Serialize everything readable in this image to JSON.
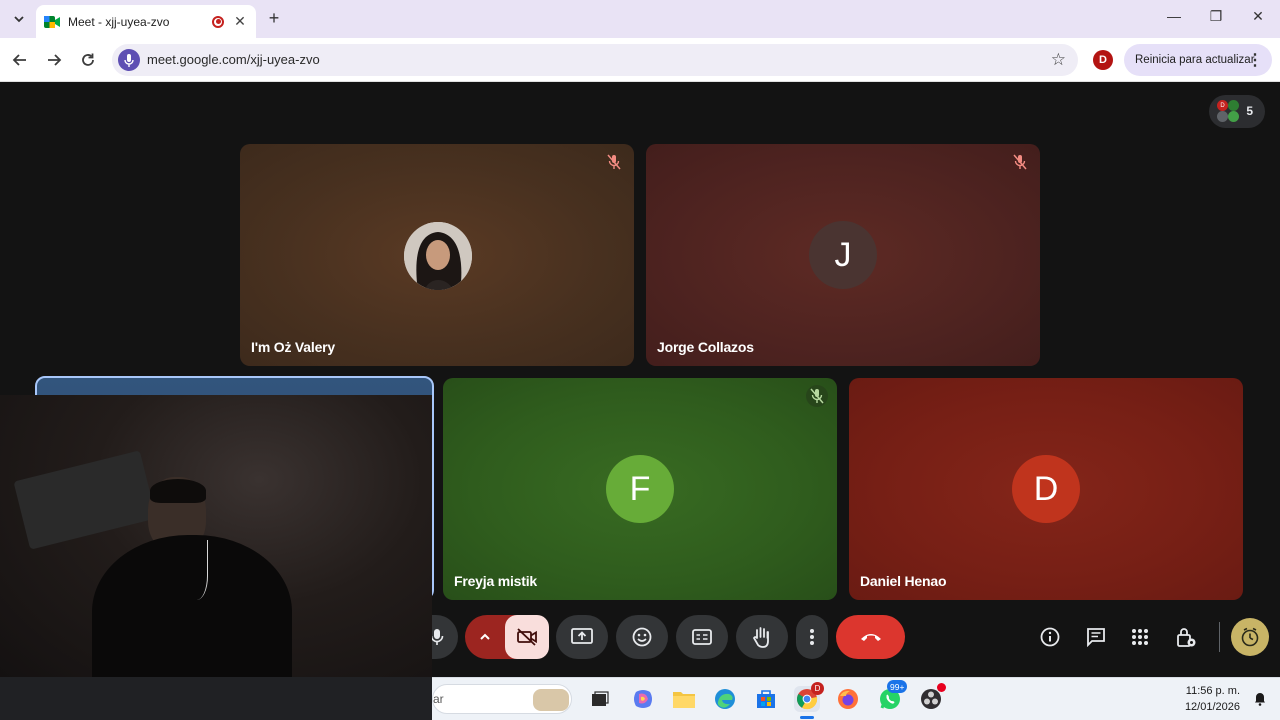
{
  "browser": {
    "tab_title": "Meet - xjj-uyea-zvo",
    "url": "meet.google.com/xjj-uyea-zvo",
    "profile_initial": "D",
    "update_label": "Reinicia para actualizar",
    "new_tab_symbol": "+",
    "tab_close_symbol": "✕",
    "window_controls": [
      "—",
      "❐",
      "✕"
    ]
  },
  "meet": {
    "participant_count": "5",
    "chip_avatar_initial": "D",
    "tiles": [
      {
        "name": "I'm Oż Valery",
        "muted": true,
        "avatar": "photo",
        "color": "#4a2e1e"
      },
      {
        "name": "Jorge Collazos",
        "muted": true,
        "avatar_letter": "J",
        "color": "#4f2320"
      },
      {
        "name": "",
        "muted": false,
        "avatar": "self-illustration",
        "color": "#2b4a6e"
      },
      {
        "name": "Freyja mistik",
        "muted": true,
        "avatar_letter": "F",
        "color": "#2e5a1c"
      },
      {
        "name": "Daniel Henao",
        "muted": false,
        "avatar_letter": "D",
        "color": "#7a1e16"
      }
    ],
    "controls": {
      "mic": "mic-icon",
      "camera_options": "chevron-up-icon",
      "camera": "camera-off-icon",
      "present": "present-screen-icon",
      "reactions": "emoji-icon",
      "captions": "captions-icon",
      "raise_hand": "hand-icon",
      "more": "more-vert-icon",
      "leave": "end-call-icon"
    },
    "side_controls": [
      "info-icon",
      "chat-icon",
      "apps-icon",
      "host-controls-icon",
      "timer-icon"
    ]
  },
  "taskbar": {
    "search_fragment": "ar",
    "time": "11:56 p. m.",
    "date": "12/01/2026",
    "whatsapp_badge": "99+",
    "chrome_badge": "D"
  }
}
